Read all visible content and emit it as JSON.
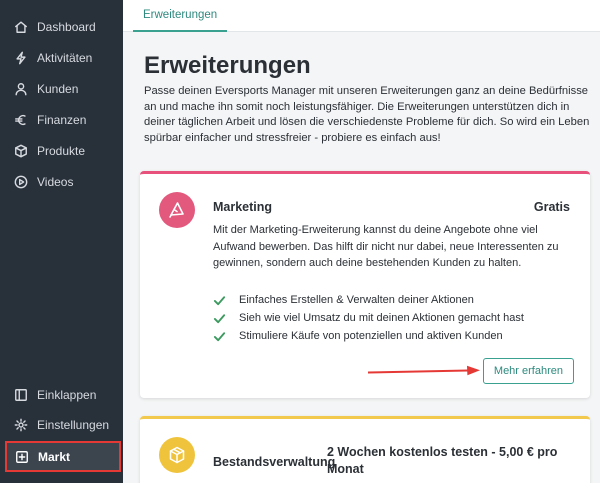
{
  "sidebar": {
    "items": [
      {
        "label": "Dashboard",
        "icon": "home-icon"
      },
      {
        "label": "Aktivitäten",
        "icon": "activity-icon"
      },
      {
        "label": "Kunden",
        "icon": "user-icon"
      },
      {
        "label": "Finanzen",
        "icon": "euro-icon"
      },
      {
        "label": "Produkte",
        "icon": "box-icon"
      },
      {
        "label": "Videos",
        "icon": "play-icon"
      }
    ],
    "bottom_items": [
      {
        "label": "Einklappen",
        "icon": "collapse-icon"
      },
      {
        "label": "Einstellungen",
        "icon": "gear-icon"
      },
      {
        "label": "Markt",
        "icon": "plus-square-icon",
        "active": true
      }
    ]
  },
  "tabs": {
    "active_label": "Erweiterungen"
  },
  "page": {
    "title": "Erweiterungen",
    "intro": "Passe deinen Eversports Manager mit unseren Erweiterungen ganz an deine Bedürfnisse an und mache ihn somit noch leistungsfähiger. Die Erweiterungen unterstützen dich in deiner täglichen Arbeit und lösen die verschiedenste Probleme für dich. So wird ein Leben spürbar einfacher und stressfreier - probiere es einfach aus!"
  },
  "extensions": [
    {
      "title": "Marketing",
      "price": "Gratis",
      "icon": "megaphone-icon",
      "accent": "#e7517b",
      "description": "Mit der Marketing-Erweiterung kannst du deine Angebote ohne viel Aufwand bewerben. Das hilft dir nicht nur dabei, neue Interessenten zu gewinnen, sondern auch deine bestehenden Kunden zu halten.",
      "features": [
        "Einfaches Erstellen & Verwalten deiner Aktionen",
        "Sieh wie viel Umsatz du mit deinen Aktionen gemacht hast",
        "Stimuliere Käufe von potenziellen und aktiven Kunden"
      ],
      "button": "Mehr erfahren"
    },
    {
      "title": "Bestandsverwaltung",
      "price": "2 Wochen kostenlos testen - 5,00 € pro Monat",
      "icon": "package-icon",
      "accent": "#f2c94c"
    }
  ],
  "colors": {
    "sidebar_bg": "#28303a",
    "accent_teal": "#3aa090",
    "highlight_red": "#e53935",
    "check_green": "#3c9a5f"
  }
}
